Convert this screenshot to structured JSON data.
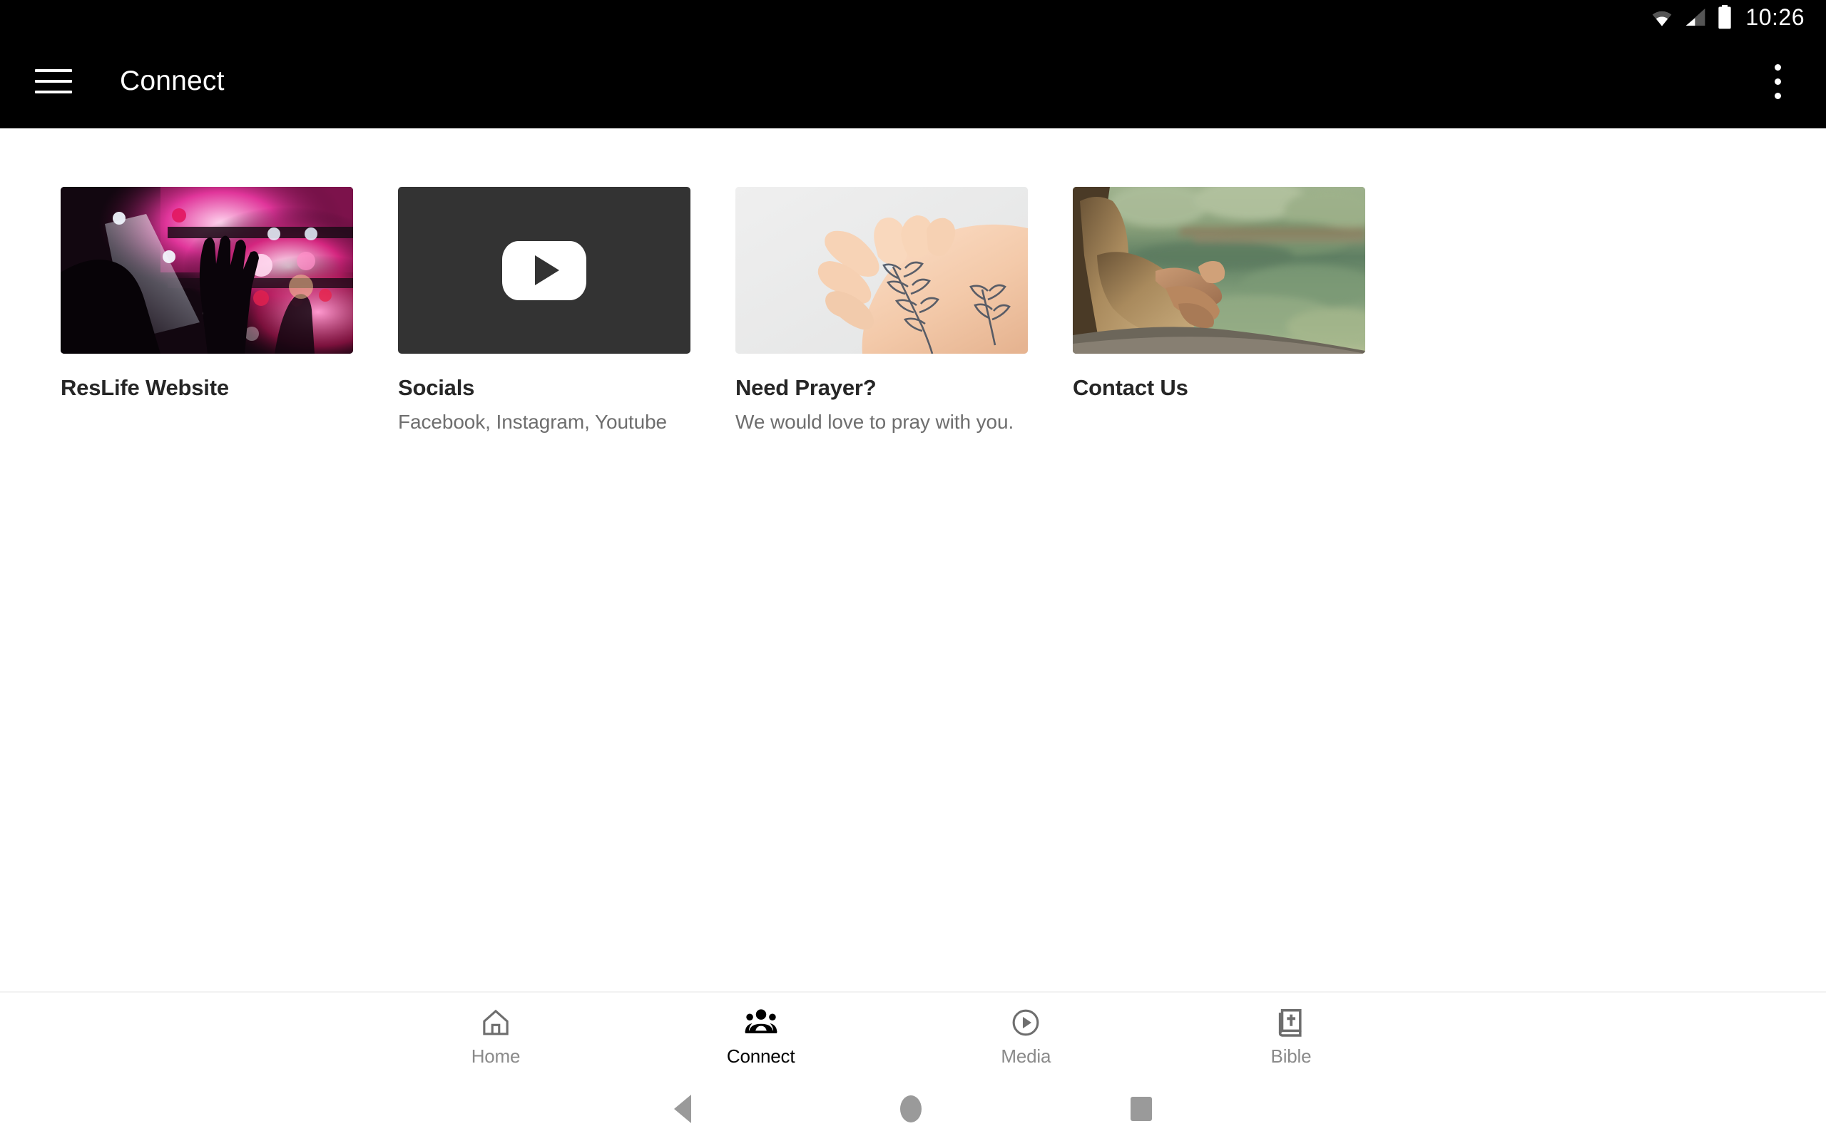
{
  "status_bar": {
    "time": "10:26",
    "icons": [
      "wifi-icon",
      "cellular-signal-icon",
      "battery-icon"
    ]
  },
  "app_bar": {
    "menu_icon": "hamburger-menu-icon",
    "title": "Connect",
    "overflow_icon": "more-vertical-icon"
  },
  "cards": [
    {
      "title": "ResLife Website",
      "subtitle": "",
      "thumb": "concert-worship-photo"
    },
    {
      "title": "Socials",
      "subtitle": "Facebook, Instagram, Youtube",
      "thumb": "youtube-video-placeholder"
    },
    {
      "title": "Need Prayer?",
      "subtitle": "We would love to pray with you.",
      "thumb": "praying-hands-photo"
    },
    {
      "title": "Contact Us",
      "subtitle": "",
      "thumb": "hands-by-lake-photo"
    }
  ],
  "bottom_nav": {
    "items": [
      {
        "label": "Home",
        "icon": "home-icon",
        "active": false
      },
      {
        "label": "Connect",
        "icon": "people-group-icon",
        "active": true
      },
      {
        "label": "Media",
        "icon": "play-circle-icon",
        "active": false
      },
      {
        "label": "Bible",
        "icon": "bible-book-icon",
        "active": false
      }
    ]
  },
  "system_nav": {
    "back": "back-triangle-icon",
    "home": "home-circle-icon",
    "recents": "recents-square-icon"
  },
  "colors": {
    "app_bar_bg": "#000000",
    "page_bg": "#ffffff",
    "title_text": "#262626",
    "subtitle_text": "#6e6e6e",
    "nav_inactive": "#8a8a8a",
    "nav_active": "#000000"
  }
}
